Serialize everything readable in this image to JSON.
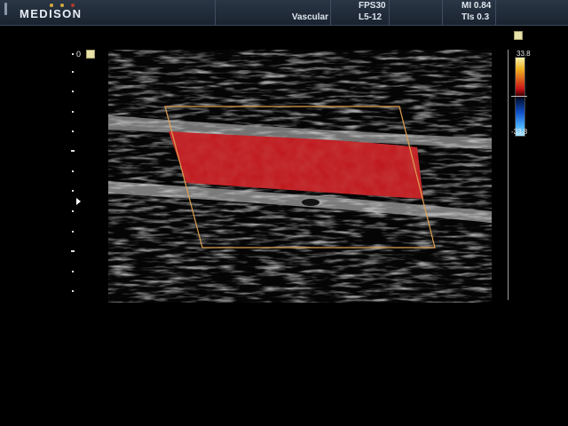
{
  "header": {
    "brand": "MEDISON",
    "brand_dots": [
      "#d2a93f",
      "#d2a93f",
      "#b13b2b"
    ],
    "preset": "Vascular",
    "fps": "FPS30",
    "probe": "L5-12",
    "mi_label": "MI",
    "mi_value": "0.84",
    "tis_label": "TIs",
    "tis_value": "0.3"
  },
  "scan": {
    "depth_zero": "0"
  },
  "color_scale": {
    "top": "33.8",
    "bottom": "-33.8"
  }
}
